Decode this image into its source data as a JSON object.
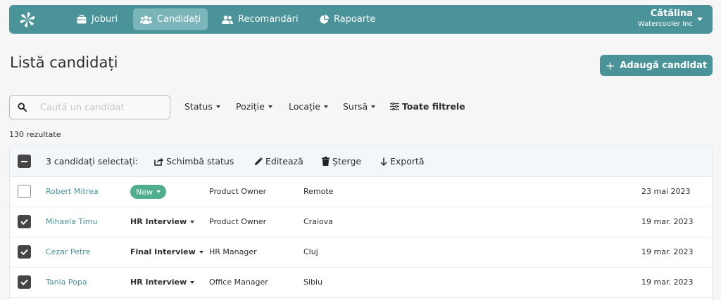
{
  "nav": {
    "items": [
      {
        "label": "Joburi",
        "icon": "briefcase-icon"
      },
      {
        "label": "Candidați",
        "icon": "users-icon",
        "active": true
      },
      {
        "label": "Recomandări",
        "icon": "user-group-icon"
      },
      {
        "label": "Rapoarte",
        "icon": "pie-chart-icon"
      }
    ],
    "user_name": "Cătălina",
    "user_org": "Watercooler Inc"
  },
  "page": {
    "title": "Listă candidați",
    "add_button": "Adaugă candidat"
  },
  "search": {
    "placeholder": "Caută un candidat",
    "value": ""
  },
  "filters": [
    "Status",
    "Poziție",
    "Locație",
    "Sursă",
    "Toate filtrele"
  ],
  "results_text": "130 rezultate",
  "bulk": {
    "selected_text": "3 candidați selectați:",
    "actions": [
      "Schimbă status",
      "Editează",
      "Șterge",
      "Exportă"
    ]
  },
  "rows": [
    {
      "checked": false,
      "name": "Robert Mitrea",
      "status": "New",
      "position": "Product Owner",
      "location": "Remote",
      "date": "23 mai 2023"
    },
    {
      "checked": true,
      "name": "Mihaela Timu",
      "status": "HR Interview",
      "position": "Product Owner",
      "location": "Craiova",
      "date": "19 mar. 2023"
    },
    {
      "checked": true,
      "name": "Cezar Petre",
      "status": "Final Interview",
      "position": "HR Manager",
      "location": "Cluj",
      "date": "19 mar. 2023"
    },
    {
      "checked": true,
      "name": "Tania Popa",
      "status": "HR Interview",
      "position": "Office Manager",
      "location": "Sibiu",
      "date": "19 mar. 2023"
    }
  ],
  "colors": {
    "brand": "#4a9399",
    "brand_light": "#7ab5b9",
    "status_new": "#4fae8d",
    "checkbox_dark": "#454545"
  }
}
